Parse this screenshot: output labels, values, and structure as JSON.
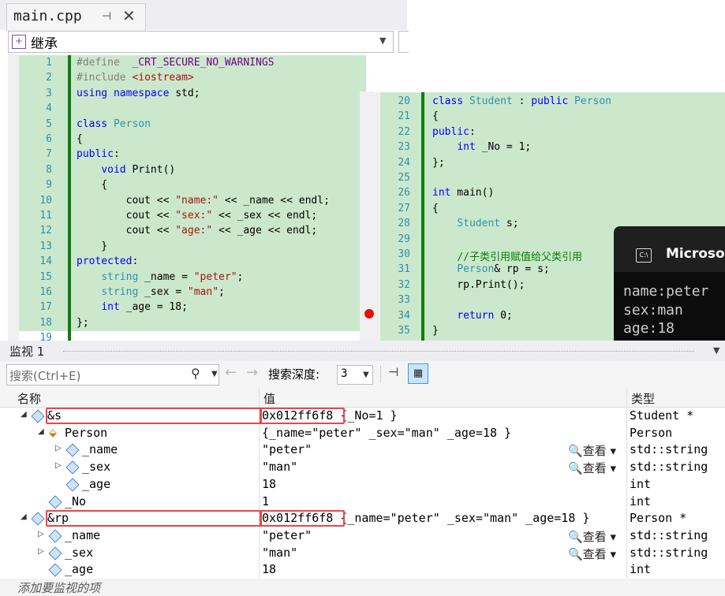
{
  "tab": {
    "title": "main.cpp",
    "pin_icon": "pin-icon",
    "close_icon": "close-icon"
  },
  "nav": {
    "scope": "继承"
  },
  "editor_left": {
    "lines": [
      {
        "n": "1",
        "html": "<span class='pp'>#define</span>  <span class='mac'>_CRT_SECURE_NO_WARNINGS</span>"
      },
      {
        "n": "2",
        "html": "<span class='pp'>#include</span> <span class='st'>&lt;iostream&gt;</span>"
      },
      {
        "n": "3",
        "html": "<span class='kw'>using namespace</span> std;"
      },
      {
        "n": "4",
        "html": ""
      },
      {
        "n": "5",
        "html": "<span class='kw'>class</span> <span class='ty'>Person</span>"
      },
      {
        "n": "6",
        "html": "{"
      },
      {
        "n": "7",
        "html": "<span class='kw'>public</span>:"
      },
      {
        "n": "8",
        "html": "    <span class='kw'>void</span> Print()"
      },
      {
        "n": "9",
        "html": "    {"
      },
      {
        "n": "10",
        "html": "        cout &lt;&lt; <span class='st'>\"name:\"</span> &lt;&lt; _name &lt;&lt; endl;"
      },
      {
        "n": "11",
        "html": "        cout &lt;&lt; <span class='st'>\"sex:\"</span> &lt;&lt; _sex &lt;&lt; endl;"
      },
      {
        "n": "12",
        "html": "        cout &lt;&lt; <span class='st'>\"age:\"</span> &lt;&lt; _age &lt;&lt; endl;"
      },
      {
        "n": "13",
        "html": "    }"
      },
      {
        "n": "14",
        "html": "<span class='kw'>protected</span>:"
      },
      {
        "n": "15",
        "html": "    <span class='ty'>string</span> _name = <span class='st'>\"peter\"</span>;"
      },
      {
        "n": "16",
        "html": "    <span class='ty'>string</span> _sex = <span class='st'>\"man\"</span>;"
      },
      {
        "n": "17",
        "html": "    <span class='kw'>int</span> _age = 18;"
      },
      {
        "n": "18",
        "html": "};"
      },
      {
        "n": "19",
        "html": ""
      }
    ]
  },
  "editor_right": {
    "lines": [
      {
        "n": "20",
        "html": "<span class='kw'>class</span> <span class='ty'>Student</span> : <span class='kw'>public</span> <span class='ty'>Person</span>"
      },
      {
        "n": "21",
        "html": "{"
      },
      {
        "n": "22",
        "html": "<span class='kw'>public</span>:"
      },
      {
        "n": "23",
        "html": "    <span class='kw'>int</span> _No = 1;"
      },
      {
        "n": "24",
        "html": "};"
      },
      {
        "n": "25",
        "html": ""
      },
      {
        "n": "26",
        "html": "<span class='kw'>int</span> main()"
      },
      {
        "n": "27",
        "html": "{"
      },
      {
        "n": "28",
        "html": "    <span class='ty'>Student</span> s;"
      },
      {
        "n": "29",
        "html": ""
      },
      {
        "n": "30",
        "html": "    <span class='cm'>//子类引用赋值给父类引用</span>"
      },
      {
        "n": "31",
        "html": "    <span class='ty'>Person</span>&amp; rp = s;"
      },
      {
        "n": "32",
        "html": "    rp.Print();"
      },
      {
        "n": "33",
        "html": ""
      },
      {
        "n": "34",
        "html": "    <span class='kw'>return</span> 0;"
      },
      {
        "n": "35",
        "html": "}"
      }
    ]
  },
  "console": {
    "title": "Microsof",
    "icon": "console-icon",
    "output": [
      "name:peter",
      "sex:man",
      "age:18"
    ]
  },
  "watch": {
    "title": "监视 1",
    "search_placeholder": "搜索(Ctrl+E)",
    "depth_label": "搜索深度:",
    "depth_value": "3",
    "columns": {
      "name": "名称",
      "value": "值",
      "type": "类型"
    },
    "view_label": "查看",
    "add_label": "添加要监视的项",
    "rows": [
      {
        "name": "&s",
        "value": "0x012ff6f8 {_No=1 }",
        "type": "Student *",
        "indent": 0,
        "exp": "◢",
        "icon": "obj",
        "hl": true
      },
      {
        "name": "Person",
        "value": "{_name=\"peter\" _sex=\"man\" _age=18 }",
        "type": "Person",
        "indent": 1,
        "exp": "◢",
        "icon": "base",
        "hl": false
      },
      {
        "name": "_name",
        "value": "\"peter\"",
        "type": "std::string",
        "indent": 2,
        "exp": "▷",
        "icon": "obj",
        "hl": false,
        "view": true
      },
      {
        "name": "_sex",
        "value": "\"man\"",
        "type": "std::string",
        "indent": 2,
        "exp": "▷",
        "icon": "obj",
        "hl": false,
        "view": true
      },
      {
        "name": "_age",
        "value": "18",
        "type": "int",
        "indent": 2,
        "exp": "",
        "icon": "obj",
        "hl": false
      },
      {
        "name": "_No",
        "value": "1",
        "type": "int",
        "indent": 1,
        "exp": "",
        "icon": "obj",
        "hl": false
      },
      {
        "name": "&rp",
        "value": "0x012ff6f8 {_name=\"peter\" _sex=\"man\" _age=18 }",
        "type": "Person *",
        "indent": 0,
        "exp": "◢",
        "icon": "obj",
        "hl": true
      },
      {
        "name": "_name",
        "value": "\"peter\"",
        "type": "std::string",
        "indent": 1,
        "exp": "▷",
        "icon": "obj",
        "hl": false,
        "view": true
      },
      {
        "name": "_sex",
        "value": "\"man\"",
        "type": "std::string",
        "indent": 1,
        "exp": "▷",
        "icon": "obj",
        "hl": false,
        "view": true
      },
      {
        "name": "_age",
        "value": "18",
        "type": "int",
        "indent": 1,
        "exp": "",
        "icon": "obj",
        "hl": false
      }
    ]
  },
  "colors": {
    "accent": "#e8474b",
    "code_bg": "#cce8cc",
    "change_bar": "#107c10"
  }
}
